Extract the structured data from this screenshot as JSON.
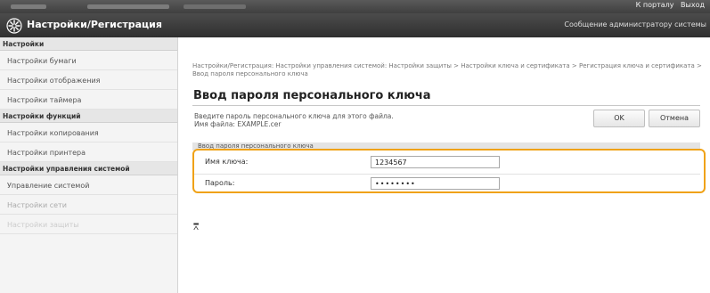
{
  "topbar": {
    "portal_link": "К порталу",
    "logout_link": "Выход"
  },
  "header": {
    "title": "Настройки/Регистрация",
    "admin_message_link": "Сообщение администратору системы",
    "icon": "gear-icon"
  },
  "sidebar": {
    "groups": [
      {
        "label": "Настройки",
        "items": [
          {
            "label": "Настройки бумаги"
          },
          {
            "label": "Настройки отображения"
          },
          {
            "label": "Настройки таймера"
          }
        ]
      },
      {
        "label": "Настройки функций",
        "items": [
          {
            "label": "Настройки копирования"
          },
          {
            "label": "Настройки принтера"
          }
        ]
      },
      {
        "label": "Настройки управления системой",
        "items": [
          {
            "label": "Управление системой"
          },
          {
            "label": "Настройки сети"
          },
          {
            "label": "Настройки защиты"
          }
        ]
      }
    ]
  },
  "main": {
    "breadcrumb": "Настройки/Регистрация: Настройки управления системой: Настройки защиты > Настройки ключа и сертификата > Регистрация ключа и сертификата > Ввод пароля персонального ключа",
    "title": "Ввод пароля персонального ключа",
    "description": "Введите пароль персонального ключа для этого файла.",
    "file_name_line": "Имя файла: EXAMPLE.cer",
    "ok_label": "OK",
    "cancel_label": "Отмена",
    "section_title": "Ввод пароля персонального ключа",
    "key_name_label": "Имя ключа:",
    "key_name_value": "1234567",
    "password_label": "Пароль:",
    "password_value": "••••••••",
    "to_top_glyph": "⩞"
  },
  "colors": {
    "highlight": "#f0a216",
    "header_bg": "#3a3a3a"
  }
}
